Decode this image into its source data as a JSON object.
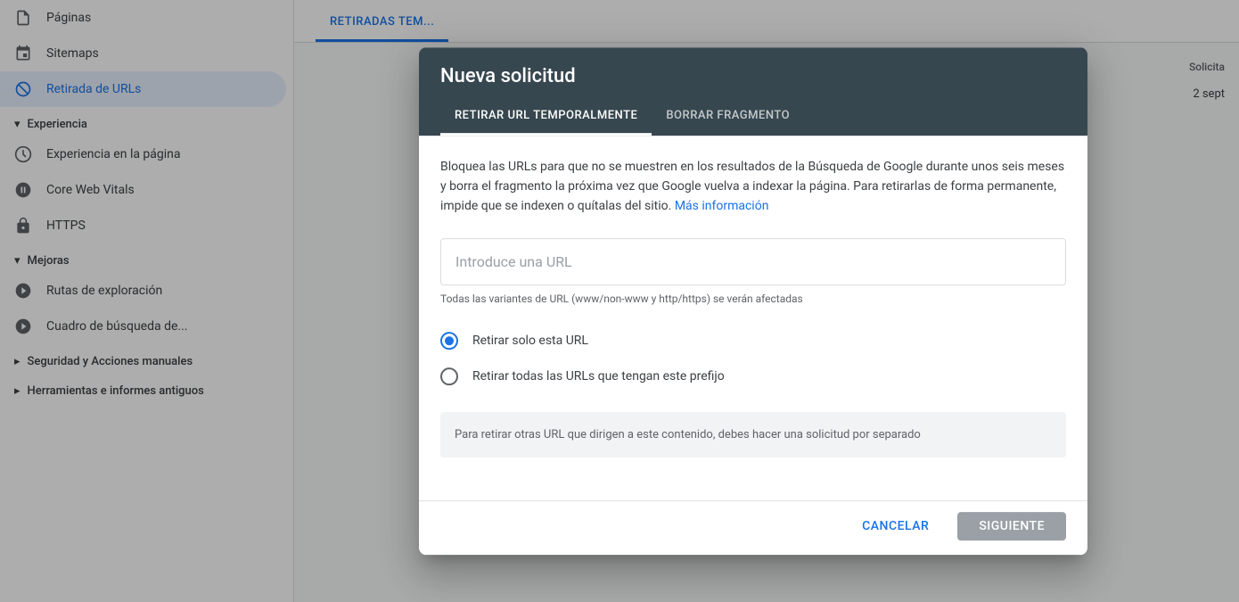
{
  "sidebar": {
    "items": [
      {
        "id": "paginas",
        "label": "Páginas",
        "icon": "pages"
      },
      {
        "id": "sitemaps",
        "label": "Sitemaps",
        "icon": "sitemap"
      },
      {
        "id": "retirada-urls",
        "label": "Retirada de URLs",
        "icon": "block",
        "active": true
      }
    ],
    "sections": [
      {
        "id": "experiencia",
        "label": "Experiencia",
        "expanded": true,
        "items": [
          {
            "id": "experiencia-pagina",
            "label": "Experiencia en la página",
            "icon": "experience"
          },
          {
            "id": "core-web-vitals",
            "label": "Core Web Vitals",
            "icon": "speed"
          },
          {
            "id": "https",
            "label": "HTTPS",
            "icon": "lock"
          }
        ]
      },
      {
        "id": "mejoras",
        "label": "Mejoras",
        "expanded": true,
        "items": [
          {
            "id": "rutas-exploracion",
            "label": "Rutas de exploración",
            "icon": "explore"
          },
          {
            "id": "cuadro-busqueda",
            "label": "Cuadro de búsqueda de...",
            "icon": "search"
          }
        ]
      },
      {
        "id": "seguridad",
        "label": "Seguridad y Acciones manuales",
        "expanded": false,
        "items": []
      },
      {
        "id": "herramientas",
        "label": "Herramientas e informes antiguos",
        "expanded": false,
        "items": []
      }
    ]
  },
  "main": {
    "tabs": [
      {
        "id": "retiradas-temp",
        "label": "RETIRADAS TEM...",
        "active": true
      },
      {
        "id": "tab2",
        "label": "",
        "active": false
      }
    ],
    "table": {
      "col_header": "Solicita",
      "row_date": "2 sept"
    }
  },
  "dialog": {
    "title": "Nueva solicitud",
    "tabs": [
      {
        "id": "retirar-url",
        "label": "RETIRAR URL TEMPORALMENTE",
        "active": true
      },
      {
        "id": "borrar-fragmento",
        "label": "BORRAR FRAGMENTO",
        "active": false
      }
    ],
    "description": "Bloquea las URLs para que no se muestren en los resultados de la Búsqueda de Google durante unos seis meses y borra el fragmento la próxima vez que Google vuelva a indexar la página. Para retirarlas de forma permanente, impide que se indexen o quítalas del sitio.",
    "more_info_link": "Más información",
    "url_input_placeholder": "Introduce una URL",
    "url_hint": "Todas las variantes de URL (www/non-www y http/https) se verán afectadas",
    "radio_options": [
      {
        "id": "only-url",
        "label": "Retirar solo esta URL",
        "selected": true
      },
      {
        "id": "prefix-url",
        "label": "Retirar todas las URLs que tengan este prefijo",
        "selected": false
      }
    ],
    "info_box_text": "Para retirar otras URL que dirigen a este contenido, debes hacer una solicitud por separado",
    "footer": {
      "cancel_label": "CANCELAR",
      "next_label": "SIGUIENTE"
    }
  }
}
